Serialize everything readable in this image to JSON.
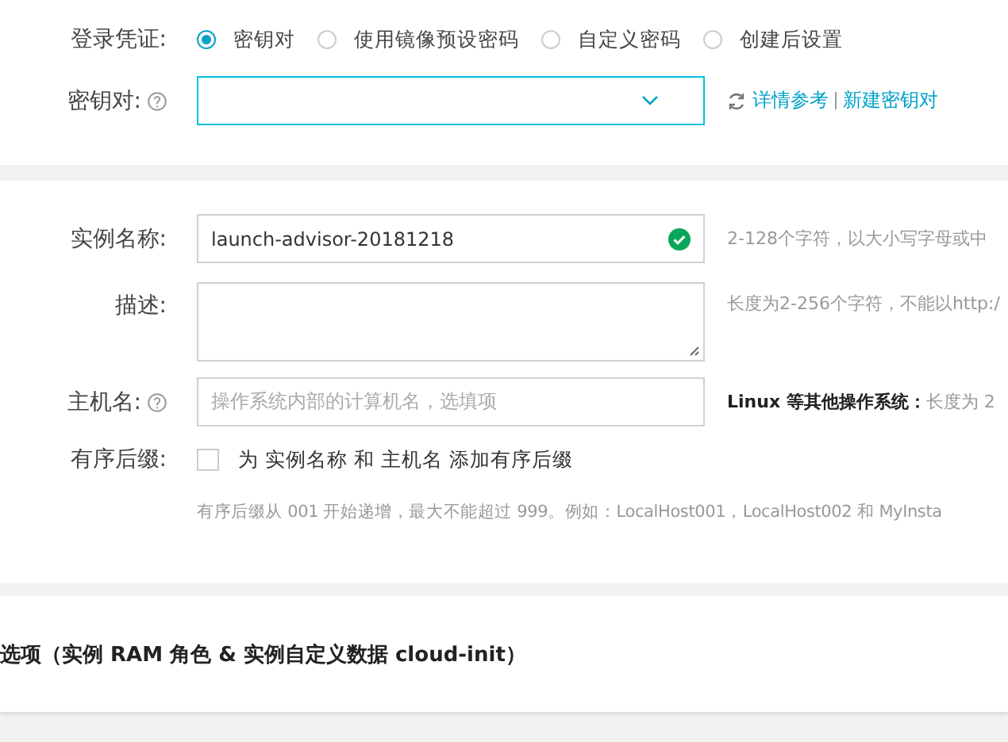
{
  "login_credential": {
    "label": "登录凭证:",
    "options": [
      {
        "label": "密钥对",
        "selected": true
      },
      {
        "label": "使用镜像预设密码",
        "selected": false
      },
      {
        "label": "自定义密码",
        "selected": false
      },
      {
        "label": "创建后设置",
        "selected": false
      }
    ]
  },
  "key_pair": {
    "label": "密钥对:",
    "links": [
      "详情参考",
      "新建密钥对"
    ]
  },
  "instance_name": {
    "label": "实例名称:",
    "value": "launch-advisor-20181218",
    "valid": true,
    "hint": "2-128个字符，以大小写字母或中"
  },
  "description": {
    "label": "描述:",
    "hint": "长度为2-256个字符，不能以http:/"
  },
  "hostname": {
    "label": "主机名:",
    "placeholder": "操作系统内部的计算机名，选填项",
    "hint": "**Linux 等其他操作系统：**长度为 2"
  },
  "ordered_suffix": {
    "label": "有序后缀:",
    "checked": false,
    "option": "为 实例名称 和 主机名 添加有序后缀",
    "note": "有序后缀从 001 开始递增，最大不能超过 999。例如：LocalHost001，LocalHost002 和 MyInsta"
  },
  "advanced": {
    "title": "选项（实例 RAM 角色 & 实例自定义数据 cloud-init）"
  }
}
